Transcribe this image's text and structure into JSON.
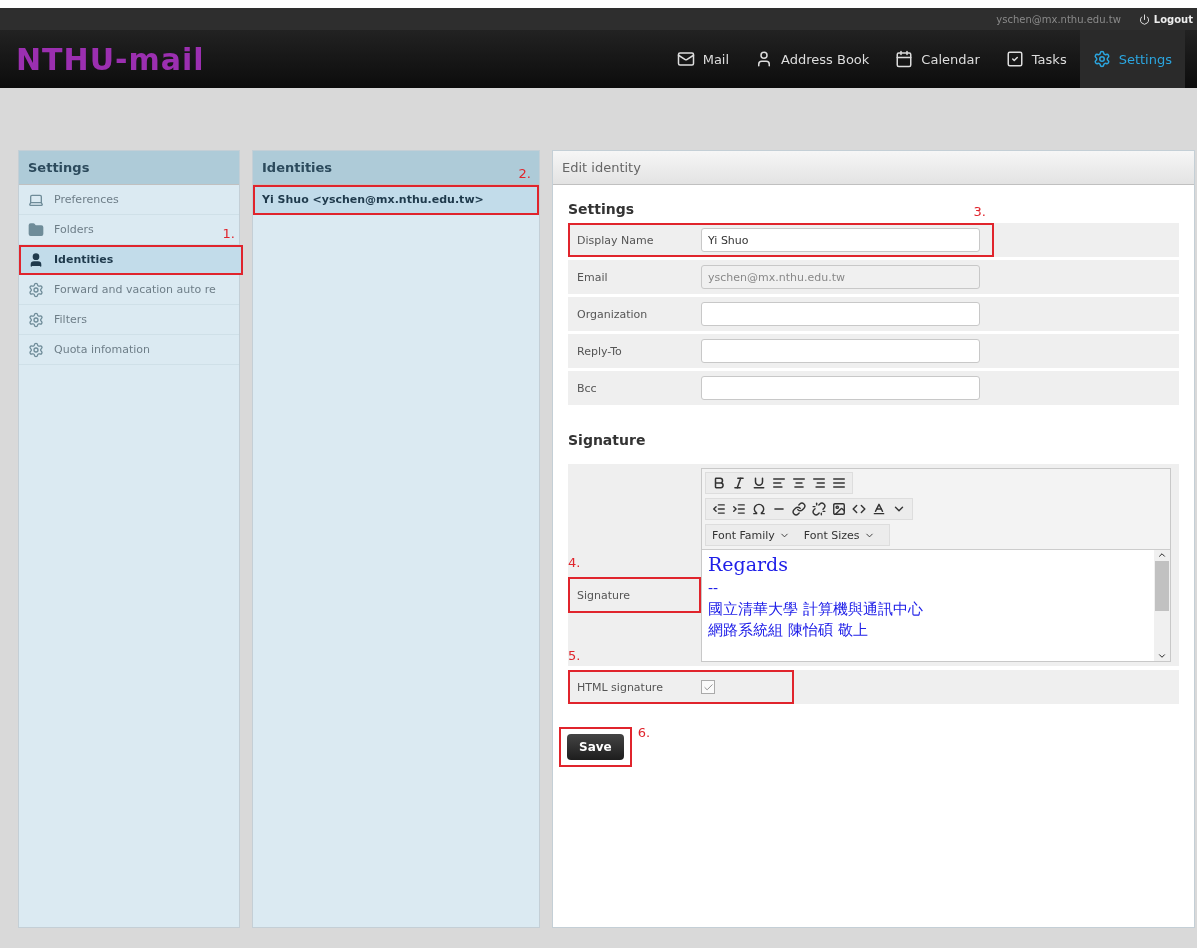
{
  "header": {
    "logo": "NTHU-mail",
    "user": "yschen@mx.nthu.edu.tw",
    "logout": "Logout",
    "nav": [
      {
        "label": "Mail",
        "kind": "mail",
        "selected": false
      },
      {
        "label": "Address Book",
        "kind": "contacts",
        "selected": false
      },
      {
        "label": "Calendar",
        "kind": "calendar",
        "selected": false
      },
      {
        "label": "Tasks",
        "kind": "tasks",
        "selected": false
      },
      {
        "label": "Settings",
        "kind": "settings",
        "selected": true
      }
    ]
  },
  "settings_panel": {
    "title": "Settings",
    "items": [
      {
        "label": "Preferences",
        "kind": "preferences",
        "selected": false
      },
      {
        "label": "Folders",
        "kind": "folders",
        "selected": false
      },
      {
        "label": "Identities",
        "kind": "identities",
        "selected": true,
        "annotation": "1."
      },
      {
        "label": "Forward and vacation auto re",
        "kind": "option",
        "selected": false
      },
      {
        "label": "Filters",
        "kind": "option",
        "selected": false
      },
      {
        "label": "Quota infomation",
        "kind": "option",
        "selected": false
      }
    ]
  },
  "identities_panel": {
    "title": "Identities",
    "items": [
      {
        "label": "Yi Shuo <yschen@mx.nthu.edu.tw>",
        "selected": true,
        "annotation": "2."
      }
    ]
  },
  "edit_panel": {
    "title": "Edit identity",
    "settings_heading": "Settings",
    "fields": [
      {
        "label": "Display Name",
        "value": "Yi Shuo",
        "disabled": false,
        "annotation": "3."
      },
      {
        "label": "Email",
        "value": "yschen@mx.nthu.edu.tw",
        "disabled": true
      },
      {
        "label": "Organization",
        "disabled": false
      },
      {
        "label": "Reply-To",
        "disabled": false
      },
      {
        "label": "Bcc",
        "disabled": false
      }
    ],
    "signature_heading": "Signature",
    "signature": {
      "label": "Signature",
      "annotation": "4.",
      "font_family": "Font Family",
      "font_sizes": "Font Sizes",
      "lines": [
        "Regards",
        "--",
        "國立清華大學 計算機與通訊中心",
        "網路系統組 陳怡碩 敬上"
      ]
    },
    "html_signature": {
      "label": "HTML signature",
      "checked": true,
      "annotation": "5."
    },
    "save": {
      "label": "Save",
      "annotation": "6."
    }
  }
}
